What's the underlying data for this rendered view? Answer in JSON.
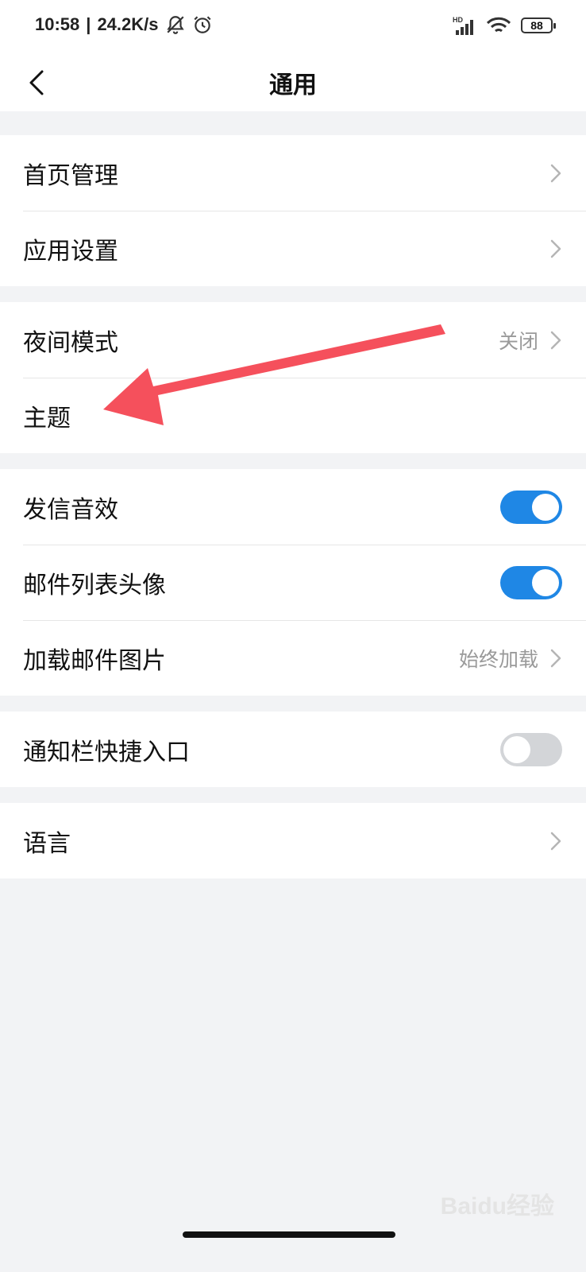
{
  "status_bar": {
    "time": "10:58",
    "net_speed": "24.2K/s",
    "battery": "88",
    "signal_label": "HD"
  },
  "nav": {
    "title": "通用",
    "back_icon": "chevron-left-icon"
  },
  "groups": [
    {
      "rows": [
        {
          "label": "首页管理",
          "value": "",
          "control": "chevron"
        },
        {
          "label": "应用设置",
          "value": "",
          "control": "chevron"
        }
      ]
    },
    {
      "rows": [
        {
          "label": "夜间模式",
          "value": "关闭",
          "control": "chevron"
        },
        {
          "label": "主题",
          "value": "",
          "control": "none"
        }
      ]
    },
    {
      "rows": [
        {
          "label": "发信音效",
          "value": "",
          "control": "toggle",
          "on": true
        },
        {
          "label": "邮件列表头像",
          "value": "",
          "control": "toggle",
          "on": true
        },
        {
          "label": "加载邮件图片",
          "value": "始终加载",
          "control": "chevron"
        }
      ]
    },
    {
      "rows": [
        {
          "label": "通知栏快捷入口",
          "value": "",
          "control": "toggle",
          "on": false
        }
      ]
    },
    {
      "rows": [
        {
          "label": "语言",
          "value": "",
          "control": "chevron"
        }
      ]
    }
  ],
  "colors": {
    "toggle_on": "#1f87e5",
    "toggle_off": "#d3d5d8",
    "annotation_arrow": "#f5505c",
    "background": "#f2f3f5"
  },
  "watermark": "Baidu经验"
}
